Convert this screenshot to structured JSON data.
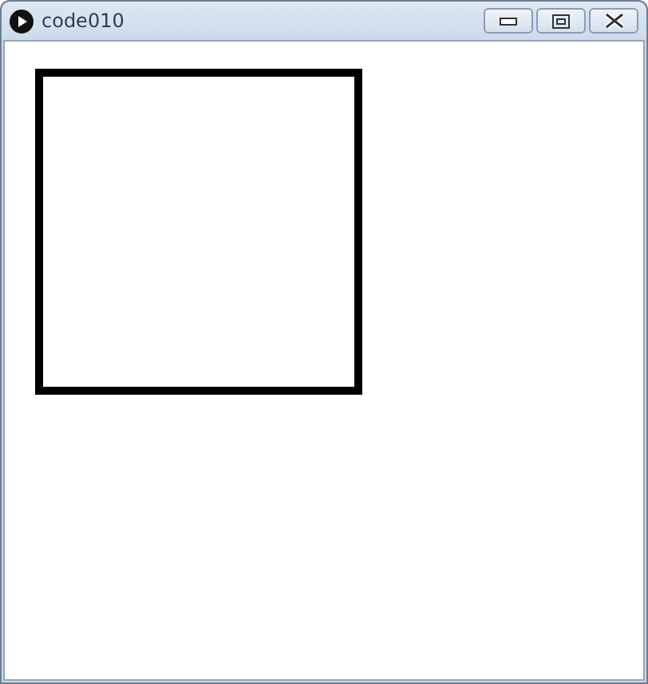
{
  "window": {
    "title": "code010"
  }
}
